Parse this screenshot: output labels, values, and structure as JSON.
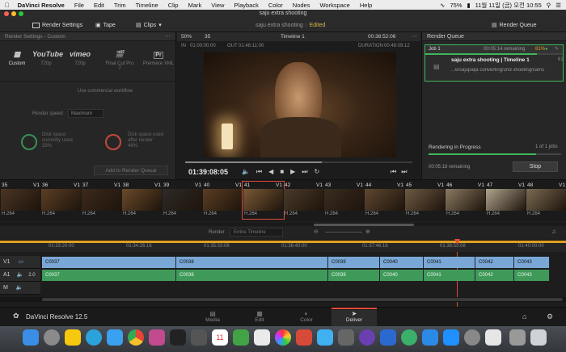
{
  "menubar": {
    "app_name": "DaVinci Resolve",
    "items": [
      "File",
      "Edit",
      "Trim",
      "Timeline",
      "Clip",
      "Mark",
      "View",
      "Playback",
      "Color",
      "Nodes",
      "Workspace",
      "Help"
    ],
    "battery": "75%",
    "date_time": "11월 11일 (금) 오전 10:55"
  },
  "window_title": "saju extra shooting",
  "toolbar": {
    "render_settings": "Render Settings",
    "tape": "Tape",
    "clips": "Clips",
    "project_name": "saju extra shooting",
    "project_status": "Edited",
    "render_queue": "Render Queue"
  },
  "render_settings": {
    "header": "Render Settings - Custom",
    "presets": [
      {
        "icon": "film-strip-icon",
        "label": "Custom",
        "logo": ""
      },
      {
        "icon": "youtube-icon",
        "label": "720p",
        "logo": "YouTube"
      },
      {
        "icon": "vimeo-icon",
        "label": "720p",
        "logo": "vimeo"
      },
      {
        "icon": "clapper-icon",
        "label": "Final Cut Pro 7",
        "logo": ""
      },
      {
        "icon": "premiere-icon",
        "label": "Premiere XML",
        "logo": "Pr"
      }
    ],
    "commercial_workflow": "Use commercial workflow",
    "render_speed_label": "Render speed",
    "render_speed_value": "Maximum",
    "disk_current_label": "Disk space currently used",
    "disk_current_value": "33%",
    "disk_after_label": "Disk space used after render",
    "disk_after_value": "46%",
    "add_to_queue": "Add to Render Queue"
  },
  "viewer": {
    "zoom": "50%",
    "clip_num": "35",
    "timeline_name": "Timeline 1",
    "source_tc": "00:38:52:06",
    "in_label": "IN",
    "in_tc": "01:00:00:00",
    "out_label": "OUT",
    "out_tc": "01:48:11:00",
    "duration_label": "DURATION",
    "duration_tc": "00:48:09:12",
    "current_tc": "01:39:08:05",
    "scrub_progress": 0.6
  },
  "render_queue": {
    "header": "Render Queue",
    "job_label": "Job 1",
    "job_remaining": "00:05:14 remaining",
    "job_percent": "81%",
    "job_title": "saju extra shooting | Timeline 1",
    "job_side": "61",
    "job_path": "...6/sajupalja converting/2nd shooting/cam1",
    "status": "Rendering in Progress",
    "count": "1 of 1 jobs",
    "remaining": "00:05:18 remaining",
    "stop": "Stop",
    "progress": 0.81
  },
  "clips": [
    {
      "num": "35",
      "track": "V1",
      "codec": "H.264"
    },
    {
      "num": "36",
      "track": "V1",
      "codec": "H.264"
    },
    {
      "num": "37",
      "track": "V1",
      "codec": "H.264"
    },
    {
      "num": "38",
      "track": "V1",
      "codec": "H.264"
    },
    {
      "num": "39",
      "track": "V1",
      "codec": "H.264"
    },
    {
      "num": "40",
      "track": "V1",
      "codec": "H.264"
    },
    {
      "num": "41",
      "track": "V1",
      "codec": "H.264"
    },
    {
      "num": "42",
      "track": "V1",
      "codec": "H.264"
    },
    {
      "num": "43",
      "track": "V1",
      "codec": "H.264"
    },
    {
      "num": "44",
      "track": "V1",
      "codec": "H.264"
    },
    {
      "num": "45",
      "track": "V1",
      "codec": "H.264"
    },
    {
      "num": "46",
      "track": "V1",
      "codec": "H.264"
    },
    {
      "num": "47",
      "track": "V1",
      "codec": "H.264"
    },
    {
      "num": "48",
      "track": "V1",
      "codec": "H.264"
    }
  ],
  "timeline_bar": {
    "render_label": "Render",
    "render_value": "Entire Timeline"
  },
  "ruler": [
    "01:33:20:00",
    "01:34:26:16",
    "01:35:33:08",
    "01:36:40:00",
    "01:37:46:16",
    "01:38:53:08",
    "01:40:00:00"
  ],
  "tracks": {
    "v1": {
      "name": "V1",
      "clips": [
        "C0037",
        "C0038",
        "C0039",
        "C0040",
        "C0041",
        "C0042",
        "C0043"
      ]
    },
    "a1": {
      "name": "A1",
      "level": "2.0",
      "clips": [
        "C0037",
        "C0038",
        "C0039",
        "C0040",
        "C0041",
        "C0042",
        "C0043"
      ]
    },
    "m": {
      "name": "M"
    }
  },
  "pagebar": {
    "brand": "DaVinci Resolve 12.5",
    "pages": [
      "Media",
      "Edit",
      "Color",
      "Deliver"
    ],
    "active": "Deliver"
  },
  "dock_calendar_day": "11",
  "colors": {
    "accent": "#e24a3a",
    "active_green": "#3fb65a",
    "video_clip": "#7aa8d6",
    "audio_clip": "#3f9a5a"
  }
}
